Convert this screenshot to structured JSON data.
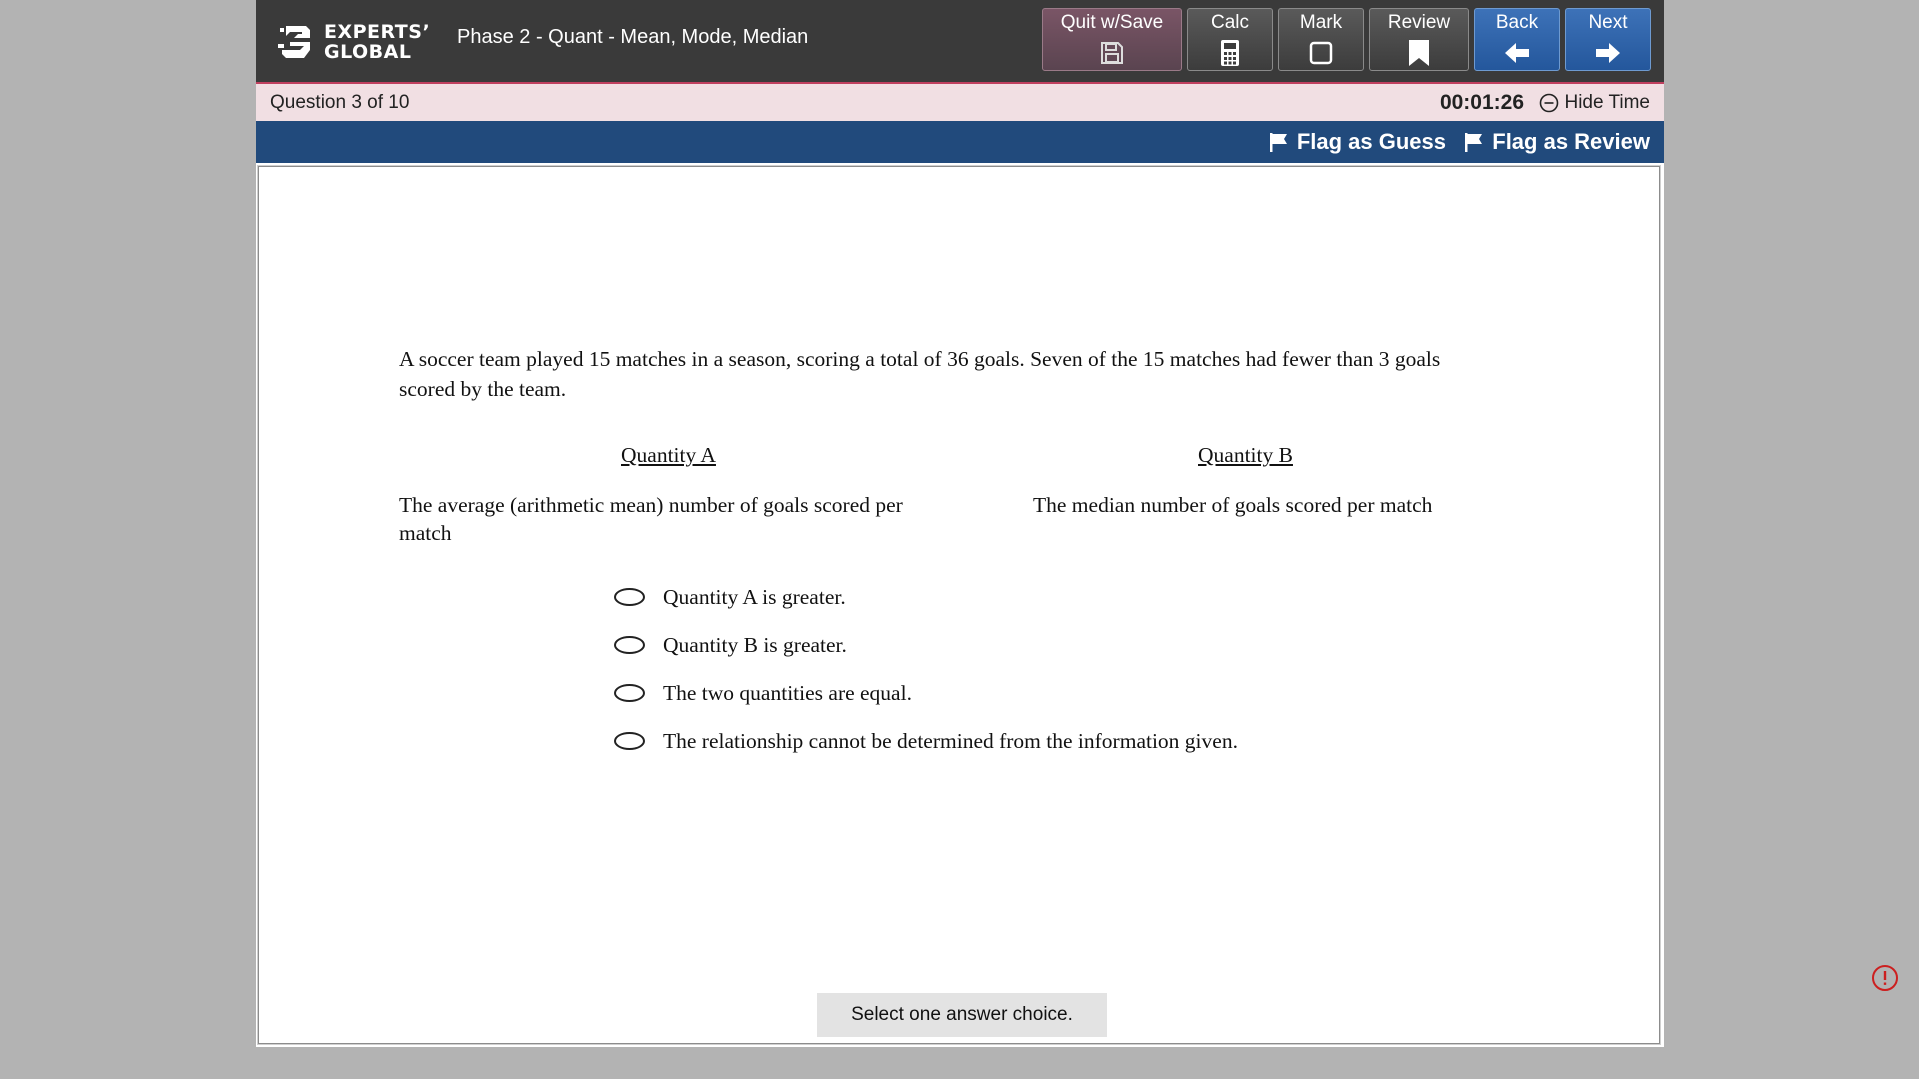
{
  "header": {
    "logo_line1": "EXPERTS’",
    "logo_line2": "GLOBAL",
    "title": "Phase 2 - Quant - Mean, Mode, Median",
    "buttons": {
      "quit": {
        "label": "Quit w/Save",
        "icon": "save-icon"
      },
      "calc": {
        "label": "Calc",
        "icon": "calculator-icon"
      },
      "mark": {
        "label": "Mark",
        "icon": "checkbox-icon"
      },
      "review": {
        "label": "Review",
        "icon": "bookmark-icon"
      },
      "back": {
        "label": "Back",
        "icon": "arrow-left-icon"
      },
      "next": {
        "label": "Next",
        "icon": "arrow-right-icon"
      }
    }
  },
  "status": {
    "question_counter": "Question 3 of 10",
    "timer": "00:01:26",
    "hide_time": "Hide Time"
  },
  "flags": {
    "guess": "Flag as Guess",
    "review": "Flag as Review"
  },
  "question": {
    "stem": "A soccer team played 15 matches in a season, scoring a total of 36 goals. Seven of the 15 matches had fewer than 3 goals scored by the team.",
    "quantity_a_head": "Quantity A",
    "quantity_b_head": "Quantity B",
    "quantity_a": "The average (arithmetic mean) number of goals scored per match",
    "quantity_b": "The median number of goals scored per match",
    "choices": [
      "Quantity A is greater.",
      "Quantity B is greater.",
      "The two quantities are equal.",
      "The relationship cannot be determined from the information given."
    ],
    "instruction": "Select one answer choice."
  },
  "colors": {
    "topbar": "#3a3a3a",
    "status_bar": "#f1dfe3",
    "flag_bar": "#214a7c",
    "nav_blue": "#2d62a8",
    "alert_red": "#cc1f1f"
  }
}
